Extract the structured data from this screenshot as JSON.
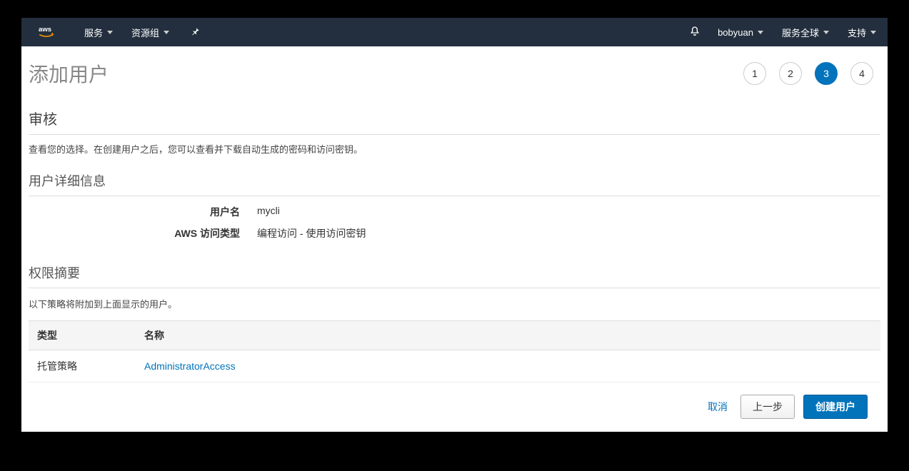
{
  "nav": {
    "services": "服务",
    "resourceGroups": "资源组",
    "user": "bobyuan",
    "region": "服务全球",
    "support": "支持"
  },
  "page": {
    "title": "添加用户",
    "steps": [
      "1",
      "2",
      "3",
      "4"
    ],
    "activeStep": 3
  },
  "review": {
    "heading": "审核",
    "desc": "查看您的选择。在创建用户之后，您可以查看并下载自动生成的密码和访问密钥。"
  },
  "userDetails": {
    "heading": "用户详细信息",
    "rows": [
      {
        "label": "用户名",
        "value": "mycli"
      },
      {
        "label": "AWS 访问类型",
        "value": "编程访问 - 使用访问密钥"
      }
    ]
  },
  "permissions": {
    "heading": "权限摘要",
    "desc": "以下策略将附加到上面显示的用户。",
    "columns": {
      "type": "类型",
      "name": "名称"
    },
    "rows": [
      {
        "type": "托管策略",
        "name": "AdministratorAccess"
      }
    ]
  },
  "footer": {
    "cancel": "取消",
    "prev": "上一步",
    "create": "创建用户"
  }
}
